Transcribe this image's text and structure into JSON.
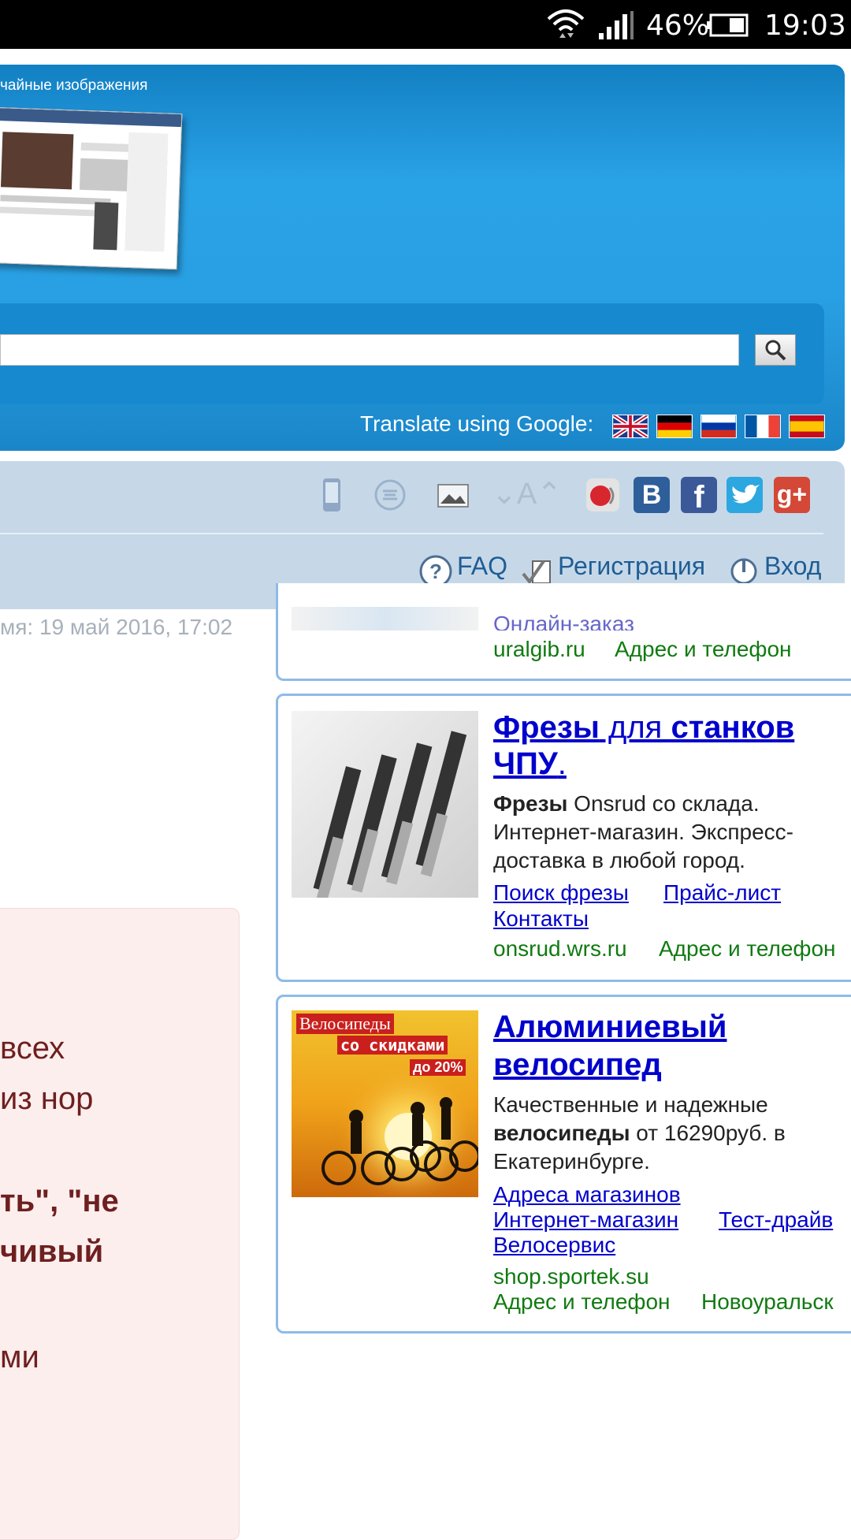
{
  "status_bar": {
    "battery": "46%",
    "time": "19:03"
  },
  "header": {
    "caption": "чайные изображения",
    "search": {
      "placeholder": ""
    },
    "translate_label": "Translate using Google:",
    "flags": [
      "english",
      "german",
      "russian",
      "french",
      "spanish"
    ]
  },
  "toolbar": {
    "icons": [
      "mobile-icon",
      "zen-icon",
      "image-icon",
      "font-size-icon",
      "speaker-icon",
      "vk-icon",
      "facebook-icon",
      "twitter-icon",
      "google-plus-icon"
    ],
    "font_size_label": "⌄A⌃",
    "vk_label": "B",
    "fb_label": "f",
    "gplus_label": "g+",
    "nav": {
      "faq": "FAQ",
      "register": "Регистрация",
      "login": "Вход"
    }
  },
  "left": {
    "updated": "мя: 19 май 2016, 17:02",
    "pink_lines": [
      "всех",
      "из нор",
      "ть\", \"не",
      "чивый",
      "ми"
    ]
  },
  "ads": [
    {
      "partial_link": "Онлайн-заказ",
      "domain": "uralgib.ru",
      "address": "Адрес и телефон"
    },
    {
      "title_bold1": "Фрезы",
      "title_mid": " для ",
      "title_bold2": "станков ЧПУ",
      "title_end": ".",
      "text_bold": "Фрезы",
      "text": " Onsrud со склада. Интернет-магазин. Экспресс-доставка в любой город.",
      "links": [
        "Поиск фрезы",
        "Прайс-лист",
        "Контакты"
      ],
      "domain": "onsrud.wrs.ru",
      "address": "Адрес и телефон"
    },
    {
      "title_line1": "Алюминиевый",
      "title_line2": "велосипед",
      "text1": "Качественные и надежные ",
      "text_bold": "велосипеды",
      "text2": " от 16290руб. в Екатеринбурге.",
      "links": [
        "Адреса магазинов",
        "Интернет-магазин",
        "Тест-драйв",
        "Велосервис"
      ],
      "domain": "shop.sportek.su",
      "address": "Адрес и телефон",
      "city": "Новоуральск",
      "image_text": {
        "line1": "Велосипеды",
        "line2": "со скидками",
        "line3": "до 20%"
      }
    }
  ]
}
